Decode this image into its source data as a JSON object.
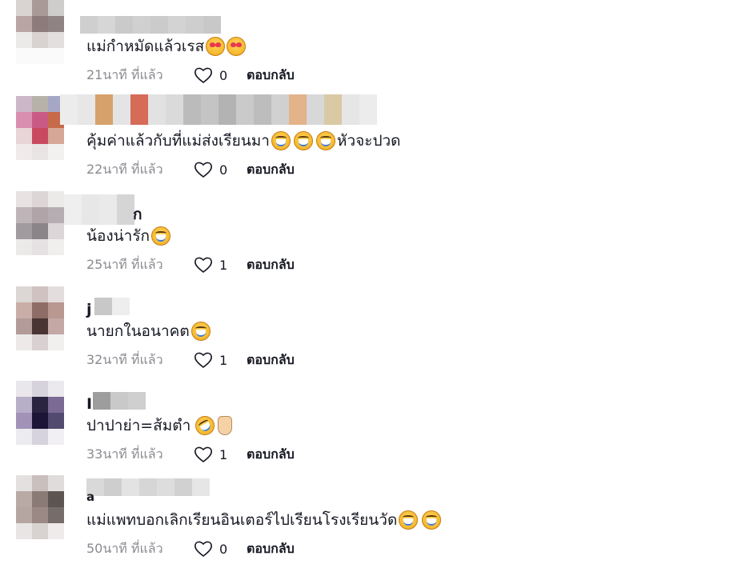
{
  "comments": [
    {
      "text": "แม่กำหมัดแล้วเรส",
      "emoji_after": [
        "smiling-face-with-heart-eyes",
        "smiling-face-with-heart-eyes"
      ],
      "time": "21นาที ที่แล้ว",
      "likes": "0",
      "reply": "ตอบกลับ"
    },
    {
      "text": "คุ้มค่าแล้วกับที่แม่ส่งเรียนมา",
      "emoji_mid": [
        "face-with-tears-of-joy",
        "face-with-tears-of-joy",
        "face-with-tears-of-joy"
      ],
      "text_tail": "หัวจะปวด",
      "time": "22นาที ที่แล้ว",
      "likes": "0",
      "reply": "ตอบกลับ"
    },
    {
      "name_partial": "ก",
      "text": "น้องน่ารัก",
      "emoji_after": [
        "face-with-tears-of-joy"
      ],
      "time": "25นาที ที่แล้ว",
      "likes": "1",
      "reply": "ตอบกลับ"
    },
    {
      "name_partial": "j",
      "text": "นายกในอนาคต",
      "emoji_after": [
        "face-with-tears-of-joy"
      ],
      "time": "32นาที ที่แล้ว",
      "likes": "1",
      "reply": "ตอบกลับ"
    },
    {
      "name_partial": "I",
      "text": "ปาปาย่า=ส้มตำ",
      "emoji_after": [
        "rolling-on-the-floor-laughing",
        "victory-hand"
      ],
      "time": "33นาที ที่แล้ว",
      "likes": "1",
      "reply": "ตอบกลับ"
    },
    {
      "name_partial": "a",
      "text": "แม่แพทบอกเลิกเรียนอินเตอร์ไปเรียนโรงเรียนวัด",
      "emoji_after": [
        "face-with-tears-of-joy",
        "face-with-tears-of-joy"
      ],
      "time": "50นาที ที่แล้ว",
      "likes": "0",
      "reply": "ตอบกลับ"
    }
  ],
  "colors": {
    "text": "#161823",
    "meta": "#8a8b91",
    "background": "#ffffff"
  }
}
